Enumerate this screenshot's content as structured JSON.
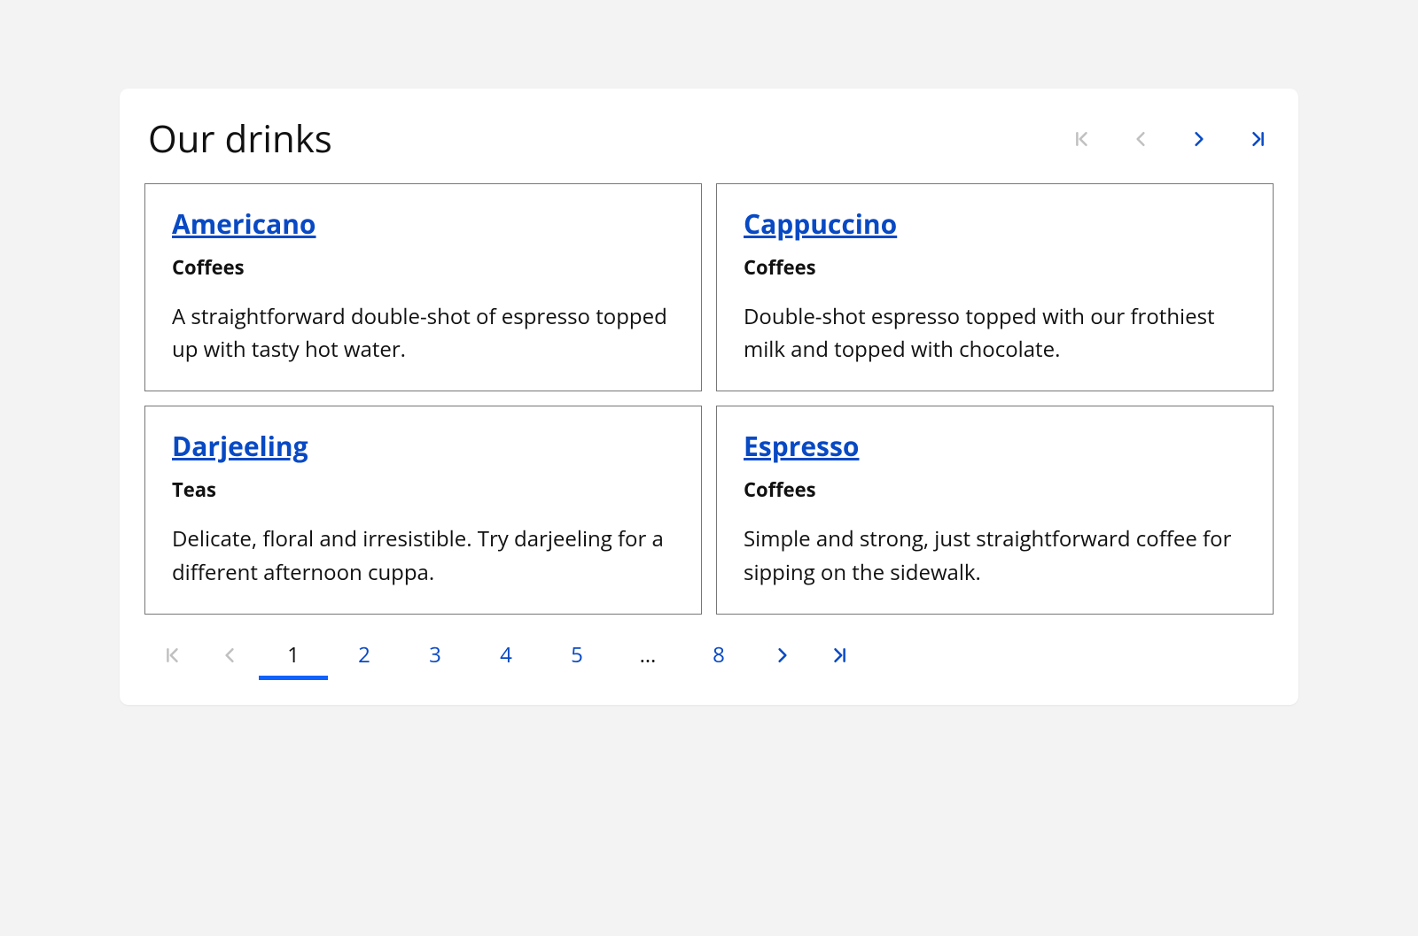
{
  "title": "Our drinks",
  "colors": {
    "link": "#0849c4",
    "accent": "#0f62fe",
    "disabled": "#c0c0c0",
    "text": "#111111"
  },
  "drinks": [
    {
      "name": "Americano",
      "category": "Coffees",
      "description": "A straightforward double-shot of espresso topped up with tasty hot water."
    },
    {
      "name": "Cappuccino",
      "category": "Coffees",
      "description": "Double-shot espresso topped with our frothiest milk and topped with chocolate."
    },
    {
      "name": "Darjeeling",
      "category": "Teas",
      "description": "Delicate, floral and irresistible. Try darjeeling for a different afternoon cuppa."
    },
    {
      "name": "Espresso",
      "category": "Coffees",
      "description": "Simple and strong, just straightforward coffee for sipping on the sidewalk."
    }
  ],
  "pagination": {
    "current": "1",
    "pages": [
      "1",
      "2",
      "3",
      "4",
      "5"
    ],
    "ellipsis": "…",
    "last": "8"
  }
}
